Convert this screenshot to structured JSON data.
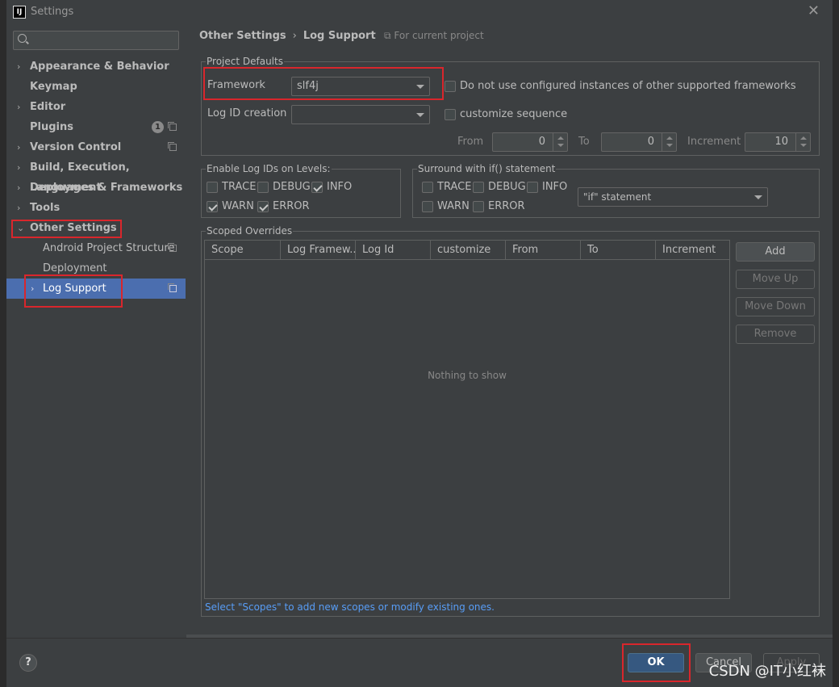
{
  "window": {
    "title": "Settings",
    "app_icon_text": "IJ"
  },
  "sidebar": {
    "search_placeholder": "",
    "items": [
      {
        "label": "Appearance & Behavior",
        "arrow": "›"
      },
      {
        "label": "Keymap",
        "arrow": ""
      },
      {
        "label": "Editor",
        "arrow": "›"
      },
      {
        "label": "Plugins",
        "arrow": "",
        "badge": "1"
      },
      {
        "label": "Version Control",
        "arrow": "›"
      },
      {
        "label": "Build, Execution, Deployment",
        "arrow": "›"
      },
      {
        "label": "Languages & Frameworks",
        "arrow": "›"
      },
      {
        "label": "Tools",
        "arrow": "›"
      },
      {
        "label": "Other Settings",
        "arrow": "⌄"
      },
      {
        "label": "Android Project Structure",
        "arrow": ""
      },
      {
        "label": "Deployment",
        "arrow": ""
      },
      {
        "label": "Log Support",
        "arrow": "›"
      }
    ]
  },
  "breadcrumb": {
    "parent": "Other Settings",
    "separator": "›",
    "current": "Log Support",
    "scope_note": "For current project"
  },
  "project_defaults": {
    "title": "Project Defaults",
    "framework_label": "Framework",
    "framework_value": "slf4j",
    "no_configured_label": "Do not use configured instances of other supported frameworks",
    "log_id_label": "Log ID creation",
    "log_id_value": "",
    "customize_label": "customize sequence",
    "from_label": "From",
    "from_value": "0",
    "to_label": "To",
    "to_value": "0",
    "increment_label": "Increment",
    "increment_value": "10"
  },
  "enable_levels": {
    "title": "Enable Log IDs on Levels:",
    "trace": "TRACE",
    "debug": "DEBUG",
    "info": "INFO",
    "warn": "WARN",
    "error": "ERROR"
  },
  "surround": {
    "title": "Surround with if() statement",
    "trace": "TRACE",
    "debug": "DEBUG",
    "info": "INFO",
    "warn": "WARN",
    "error": "ERROR",
    "statement_value": "\"if\" statement"
  },
  "scoped_overrides": {
    "title": "Scoped Overrides",
    "columns": [
      "Scope",
      "Log Framew...",
      "Log Id",
      "customize",
      "From",
      "To",
      "Increment"
    ],
    "empty_text": "Nothing to show",
    "buttons": {
      "add": "Add",
      "move_up": "Move Up",
      "move_down": "Move Down",
      "remove": "Remove"
    },
    "hint": "Select \"Scopes\" to add new scopes or modify existing ones."
  },
  "footer": {
    "help": "?",
    "ok": "OK",
    "cancel": "Cancel",
    "apply": "Apply"
  },
  "watermark": "CSDN @IT小红袜",
  "colors": {
    "accent": "#4b6eaf",
    "highlight": "#d9262c",
    "link": "#589df6"
  }
}
